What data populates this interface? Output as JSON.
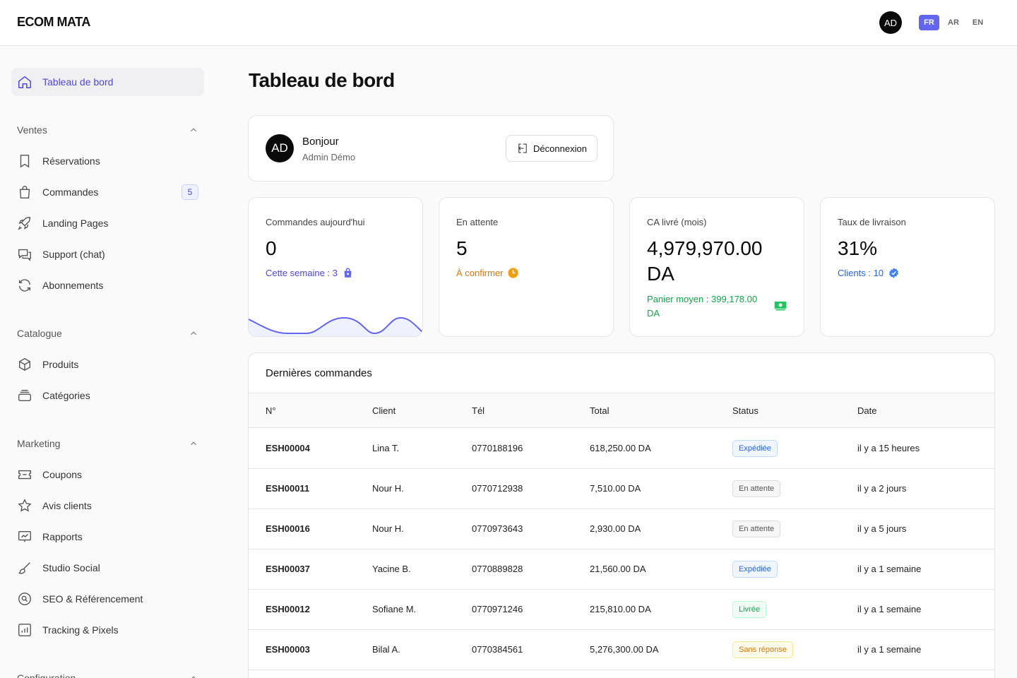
{
  "brand": "ECOM MATA",
  "header": {
    "avatar": "AD",
    "languages": [
      "FR",
      "AR",
      "EN"
    ],
    "active_language": "FR"
  },
  "sidebar": {
    "dashboard": "Tableau de bord",
    "sections": [
      {
        "title": "Ventes",
        "items": [
          "Réservations",
          "Commandes",
          "Landing Pages",
          "Support (chat)",
          "Abonnements"
        ],
        "badge": "5"
      },
      {
        "title": "Catalogue",
        "items": [
          "Produits",
          "Catégories"
        ]
      },
      {
        "title": "Marketing",
        "items": [
          "Coupons",
          "Avis clients",
          "Rapports",
          "Studio Social",
          "SEO & Référencement",
          "Tracking & Pixels"
        ]
      },
      {
        "title": "Configuration"
      }
    ]
  },
  "page_title": "Tableau de bord",
  "welcome": {
    "avatar": "AD",
    "greeting": "Bonjour",
    "user": "Admin Démo",
    "logout": "Déconnexion"
  },
  "stats": [
    {
      "label": "Commandes aujourd'hui",
      "value": "0",
      "sub": "Cette semaine : 3",
      "color": "#4f46e5"
    },
    {
      "label": "En attente",
      "value": "5",
      "sub": "À confirmer",
      "color": "#d97706"
    },
    {
      "label": "CA livré (mois)",
      "value": "4,979,970.00 DA",
      "sub": "Panier moyen : 399,178.00 DA",
      "color": "#16a34a"
    },
    {
      "label": "Taux de livraison",
      "value": "31%",
      "sub": "Clients : 10",
      "color": "#2563eb"
    }
  ],
  "orders": {
    "title": "Dernières commandes",
    "columns": [
      "N°",
      "Client",
      "Tél",
      "Total",
      "Status",
      "Date"
    ],
    "rows": [
      {
        "num": "ESH00004",
        "client": "Lina T.",
        "tel": "0770188196",
        "total": "618,250.00 DA",
        "status": "Expédiée",
        "tone": "blue",
        "date": "il y a 15 heures"
      },
      {
        "num": "ESH00011",
        "client": "Nour H.",
        "tel": "0770712938",
        "total": "7,510.00 DA",
        "status": "En attente",
        "tone": "gray",
        "date": "il y a 2 jours"
      },
      {
        "num": "ESH00016",
        "client": "Nour H.",
        "tel": "0770973643",
        "total": "2,930.00 DA",
        "status": "En attente",
        "tone": "gray",
        "date": "il y a 5 jours"
      },
      {
        "num": "ESH00037",
        "client": "Yacine B.",
        "tel": "0770889828",
        "total": "21,560.00 DA",
        "status": "Expédiée",
        "tone": "blue",
        "date": "il y a 1 semaine"
      },
      {
        "num": "ESH00012",
        "client": "Sofiane M.",
        "tel": "0770971246",
        "total": "215,810.00 DA",
        "status": "Livrée",
        "tone": "green",
        "date": "il y a 1 semaine"
      },
      {
        "num": "ESH00003",
        "client": "Bilal A.",
        "tel": "0770384561",
        "total": "5,276,300.00 DA",
        "status": "Sans réponse",
        "tone": "amber",
        "date": "il y a 1 semaine"
      }
    ]
  },
  "colors": {
    "accent": "#6366f1",
    "sidebar_active": "#4f46e5"
  }
}
